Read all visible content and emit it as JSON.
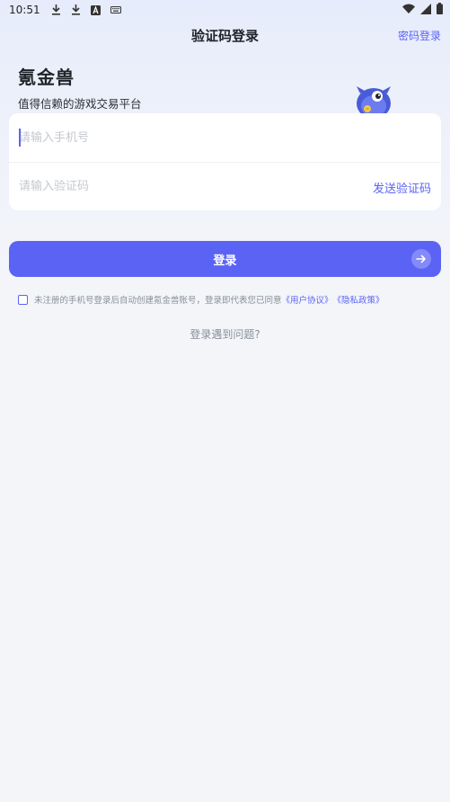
{
  "status_bar": {
    "time": "10:51",
    "icons": [
      "download-icon",
      "download-icon",
      "font-icon",
      "keyboard-icon"
    ],
    "right_icons": [
      "wifi-icon",
      "signal-icon",
      "battery-icon"
    ]
  },
  "header": {
    "title": "验证码登录",
    "password_login": "密码登录"
  },
  "brand": {
    "name": "氪金兽",
    "slogan": "值得信赖的游戏交易平台"
  },
  "form": {
    "phone_placeholder": "请输入手机号",
    "code_placeholder": "请输入验证码",
    "send_code": "发送验证码"
  },
  "login_button": {
    "label": "登录",
    "icon": "arrow-right-icon"
  },
  "agreement": {
    "checked": false,
    "text": "未注册的手机号登录后自动创建氪金兽账号，登录即代表您已同意",
    "user_agreement": "《用户协议》",
    "privacy_policy": "《隐私政策》"
  },
  "help_text": "登录遇到问题?",
  "colors": {
    "accent": "#5b63f5",
    "background": "#f3f5f9",
    "card": "#ffffff",
    "muted_text": "#8a8f99",
    "placeholder": "#c4c8cf"
  }
}
